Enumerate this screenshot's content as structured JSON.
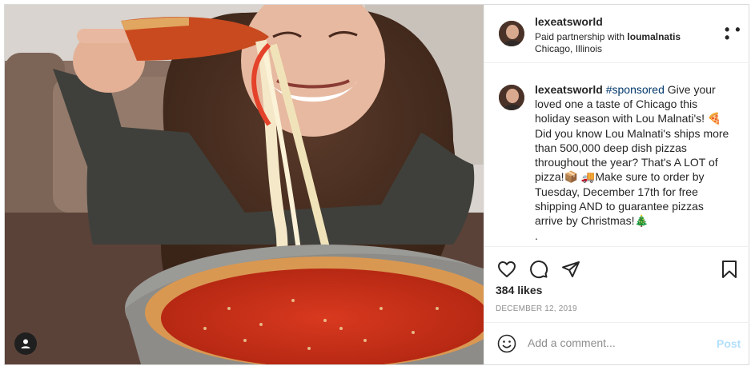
{
  "post": {
    "author": "lexeatsworld",
    "partnership_prefix": "Paid partnership with",
    "partner": "loumalnatis",
    "location": "Chicago, Illinois",
    "more_icon": "more-options-icon",
    "caption": {
      "username": "lexeatsworld",
      "hashtag": "#sponsored",
      "part1": " Give your loved one a taste of Chicago this holiday season with Lou Malnati's! ",
      "emoji1": "🍕",
      "part2": " Did you know Lou Malnati's ships more than 500,000 deep dish pizzas throughout the year? That's A LOT of pizza!",
      "emoji2": "📦",
      "emoji3": "🚚",
      "part3": "Make sure to order by Tuesday, December 17th for free shipping AND to guarantee pizzas arrive by Christmas!",
      "emoji4": "🎄",
      "trailing": "."
    },
    "likes": "384 likes",
    "date": "DECEMBER 12, 2019"
  },
  "comment": {
    "placeholder": "Add a comment...",
    "post_label": "Post"
  },
  "icons": [
    "heart-icon",
    "comment-icon",
    "share-icon",
    "bookmark-icon",
    "emoji-icon",
    "user-tag-icon"
  ]
}
